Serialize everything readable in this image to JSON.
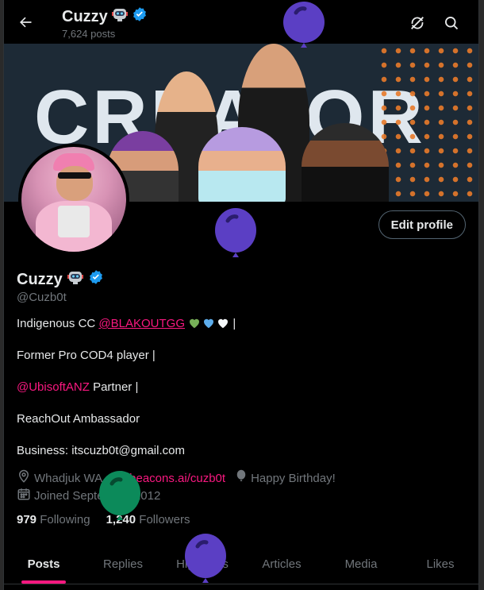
{
  "header": {
    "title": "Cuzzy",
    "posts_count": "7,624 posts"
  },
  "banner": {
    "text": "CREATOR"
  },
  "profile": {
    "edit_label": "Edit profile",
    "name": "Cuzzy",
    "handle": "@Cuzb0t",
    "bio": {
      "line1_prefix": "Indigenous CC ",
      "line1_link": "@BLAKOUTGG",
      "line1_suffix": " |",
      "line2": "Former Pro COD4 player |",
      "line3_link": "@UbisoftANZ",
      "line3_suffix": " Partner |",
      "line4": "ReachOut Ambassador",
      "line5": "Business: itscuzb0t@gmail.com"
    },
    "location": "Whadjuk WA",
    "website": "beacons.ai/cuzb0t",
    "birthday": "Happy Birthday!",
    "joined": "Joined September 2012",
    "following_count": "979",
    "following_label": "Following",
    "followers_count": "1,240",
    "followers_label": "Followers"
  },
  "tabs": [
    "Posts",
    "Replies",
    "Highlights",
    "Articles",
    "Media",
    "Likes"
  ],
  "colors": {
    "accent": "#f91880",
    "verified": "#1d9bf0",
    "balloon_purple": "#5b3fc4",
    "balloon_green": "#0c8a5a"
  },
  "icons": [
    "back-arrow-icon",
    "sync-icon",
    "search-icon",
    "robot-emoji",
    "verified-badge-icon",
    "location-icon",
    "link-icon",
    "balloon-icon",
    "calendar-icon"
  ]
}
